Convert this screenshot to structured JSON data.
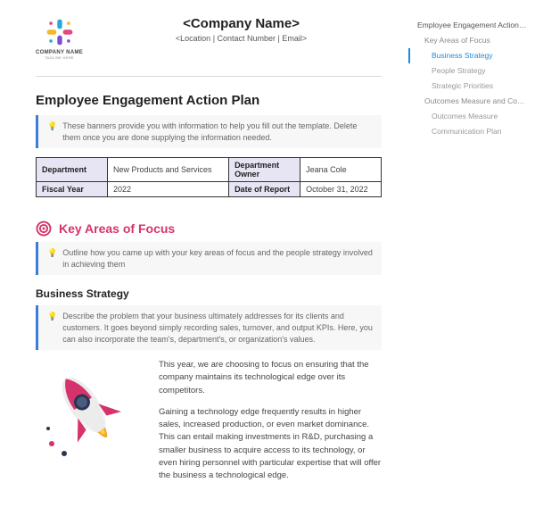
{
  "header": {
    "logo_text": "COMPANY NAME",
    "logo_tagline": "TAGLINE HERE",
    "company_name": "<Company Name>",
    "contact_line": "<Location | Contact Number | Email>"
  },
  "doc": {
    "title": "Employee Engagement Action Plan",
    "banner1": "These banners provide you with information to help you fill out the template. Delete them once you are done supplying the information needed.",
    "info": {
      "dept_label": "Department",
      "dept_value": "New Products and Services",
      "owner_label": "Department Owner",
      "owner_value": "Jeana Cole",
      "fy_label": "Fiscal Year",
      "fy_value": "2022",
      "date_label": "Date of Report",
      "date_value": "October 31, 2022"
    },
    "section1_heading": "Key Areas of Focus",
    "banner2": "Outline how you came up with your key areas of focus and the people strategy involved in achieving them",
    "sub1_heading": "Business Strategy",
    "banner3": "Describe the problem that your business ultimately addresses for its clients and customers. It goes beyond simply recording sales, turnover, and output KPIs. Here, you can also incorporate the team's, department's, or organization's values.",
    "para1": "This year, we are choosing to focus on ensuring that the company maintains its technological edge over its competitors.",
    "para2": "Gaining a technology edge frequently results in higher sales, increased production, or even market dominance. This can entail making investments in R&D, purchasing a smaller business to acquire access to its technology, or even hiring personnel with particular expertise that will offer the business a technological edge."
  },
  "outline": {
    "items": [
      {
        "label": "Employee Engagement Action Plan",
        "level": 0,
        "active": false
      },
      {
        "label": "Key Areas of Focus",
        "level": 1,
        "active": false
      },
      {
        "label": "Business Strategy",
        "level": 2,
        "active": true
      },
      {
        "label": "People Strategy",
        "level": 2,
        "active": false
      },
      {
        "label": "Strategic Priorities",
        "level": 2,
        "active": false
      },
      {
        "label": "Outcomes Measure and Communicat...",
        "level": 1,
        "active": false
      },
      {
        "label": "Outcomes Measure",
        "level": 2,
        "active": false
      },
      {
        "label": "Communication Plan",
        "level": 2,
        "active": false
      }
    ]
  },
  "icons": {
    "bulb": "💡"
  }
}
